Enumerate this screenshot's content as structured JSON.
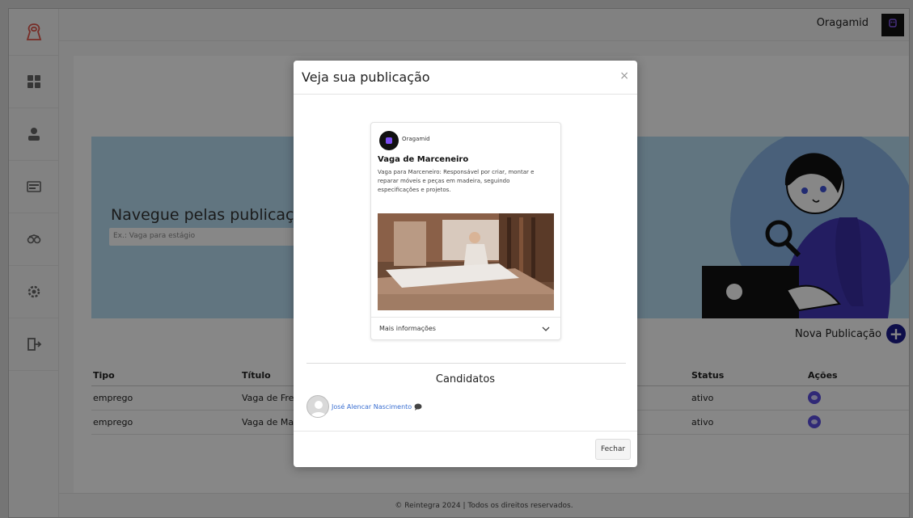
{
  "app": {
    "user_name": "Oragamid",
    "avatar_text": "ORAGAMID"
  },
  "sidebar": {
    "items": [
      {
        "icon": "dashboard-icon"
      },
      {
        "icon": "user-icon"
      },
      {
        "icon": "id-card-icon"
      },
      {
        "icon": "handshake-icon"
      },
      {
        "icon": "gear-icon"
      },
      {
        "icon": "logout-icon"
      }
    ]
  },
  "banner": {
    "title": "Navegue pelas publicações",
    "search_placeholder": "Ex.: Vaga para estágio"
  },
  "actions": {
    "new_publication": "Nova Publicação"
  },
  "table": {
    "headers": {
      "tipo": "Tipo",
      "titulo": "Título",
      "status": "Status",
      "acoes": "Ações"
    },
    "rows": [
      {
        "tipo": "emprego",
        "titulo": "Vaga de Frentis",
        "status": "ativo"
      },
      {
        "tipo": "emprego",
        "titulo": "Vaga de Marce",
        "status": "ativo"
      }
    ]
  },
  "footer": {
    "text": "© Reintegra 2024 | Todos os direitos reservados."
  },
  "modal": {
    "title": "Veja sua publicação",
    "close_symbol": "×",
    "card": {
      "user": "Oragamid",
      "title": "Vaga de Marceneiro",
      "description": "Vaga para Marceneiro: Responsável por criar, montar e reparar móveis e peças em madeira, seguindo especificações e projetos.",
      "more_label": "Mais informações"
    },
    "candidates_title": "Candidatos",
    "candidate_name": "José Alencar Nascimento",
    "close_button": "Fechar"
  },
  "colors": {
    "banner": "#b7ddf1",
    "accent": "#1c1c8c",
    "purple": "#5b4ee0",
    "logo": "#e0554a"
  }
}
